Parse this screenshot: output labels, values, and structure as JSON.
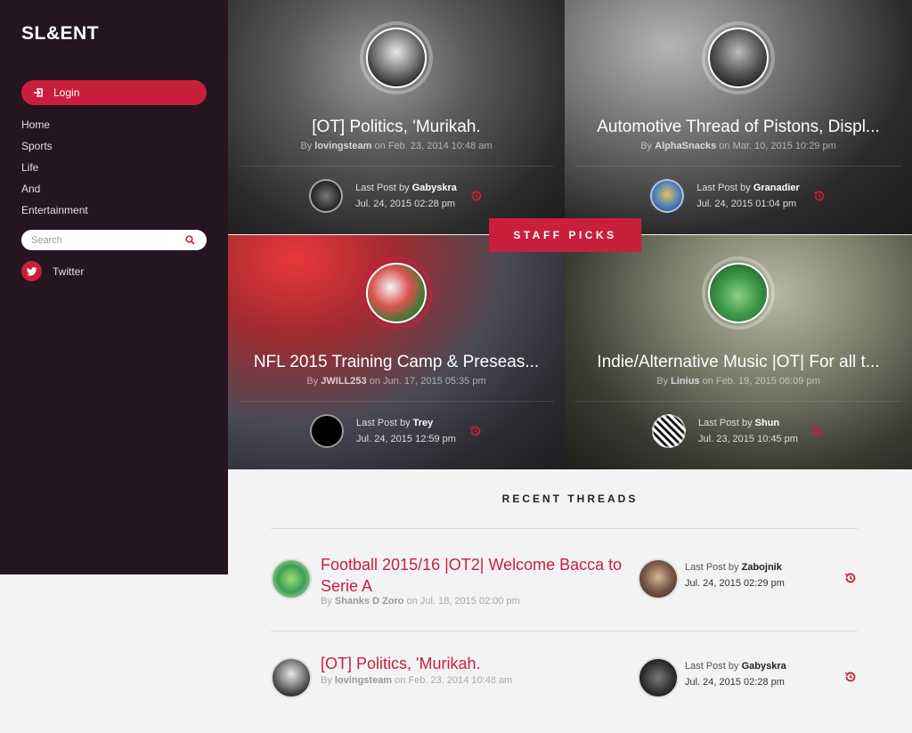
{
  "brand": "SL&ENT",
  "sidebar": {
    "login_label": "Login",
    "nav": [
      "Home",
      "Sports",
      "Life",
      "And",
      "Entertainment"
    ],
    "search_placeholder": "Search",
    "twitter_label": "Twitter"
  },
  "staff_picks_label": "STAFF PICKS",
  "staff_picks": [
    {
      "title": "[OT] Politics, 'Murikah.",
      "by": "By",
      "author": "lovingsteam",
      "on": "on",
      "date": "Feb. 23, 2014 10:48 am",
      "last_post_label": "Last Post by",
      "last_user": "Gabyskra",
      "last_date": "Jul. 24, 2015 02:28 pm"
    },
    {
      "title": "Automotive Thread of Pistons, Displ...",
      "by": "By",
      "author": "AlphaSnacks",
      "on": "on",
      "date": "Mar. 10, 2015 10:29 pm",
      "last_post_label": "Last Post by",
      "last_user": "Granadier",
      "last_date": "Jul. 24, 2015 01:04 pm"
    },
    {
      "title": "NFL 2015 Training Camp & Preseas...",
      "by": "By",
      "author": "JWILL253",
      "on": "on",
      "date": "Jun. 17, 2015 05:35 pm",
      "last_post_label": "Last Post by",
      "last_user": "Trey",
      "last_date": "Jul. 24, 2015 12:59 pm"
    },
    {
      "title": "Indie/Alternative Music |OT| For all t...",
      "by": "By",
      "author": "Linius",
      "on": "on",
      "date": "Feb. 19, 2015 06:09 pm",
      "last_post_label": "Last Post by",
      "last_user": "Shun",
      "last_date": "Jul. 23, 2015 10:45 pm"
    }
  ],
  "recent_threads_label": "RECENT THREADS",
  "recent_threads": [
    {
      "title": "Football 2015/16 |OT2| Welcome Bacca to Serie A",
      "by": "By",
      "author": "Shanks D Zoro",
      "on": "on",
      "date": "Jul. 18, 2015 02:00 pm",
      "last_post_label": "Last Post by",
      "last_user": "Zabojnik",
      "last_date": "Jul. 24, 2015 02:29 pm"
    },
    {
      "title": "[OT] Politics, 'Murikah.",
      "by": "By",
      "author": "lovingsteam",
      "on": "on",
      "date": "Feb. 23, 2014 10:48 am",
      "last_post_label": "Last Post by",
      "last_user": "Gabyskra",
      "last_date": "Jul. 24, 2015 02:28 pm"
    }
  ],
  "colors": {
    "accent": "#c81f3d",
    "sidebar_bg": "#241520",
    "page_bg": "#f3f3f3"
  },
  "icons": {
    "login": "sign-in-icon",
    "search": "search-icon",
    "twitter": "twitter-icon",
    "history": "history-icon"
  }
}
